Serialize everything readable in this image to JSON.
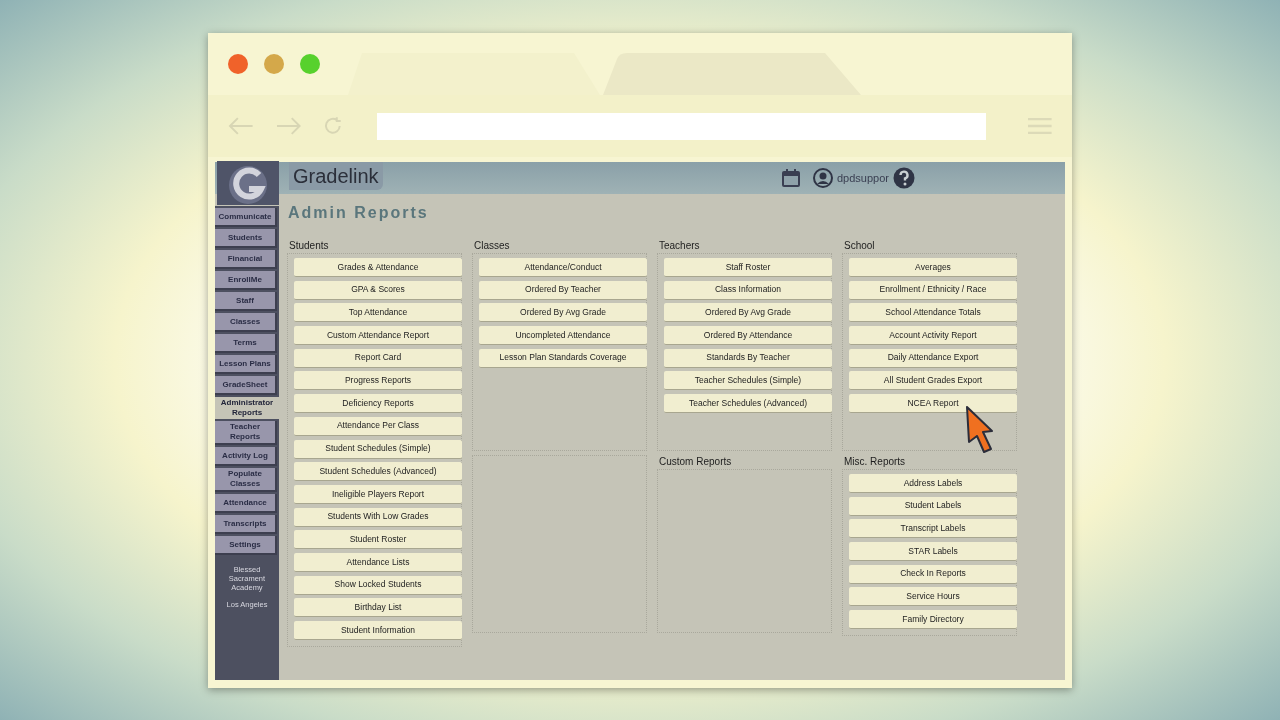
{
  "header": {
    "brand": "Gradelink",
    "user": "dpdsuppor"
  },
  "title": "Admin Reports",
  "sidebar": {
    "items": [
      {
        "label": "Communicate",
        "selected": false
      },
      {
        "label": "Students",
        "selected": false
      },
      {
        "label": "Financial",
        "selected": false
      },
      {
        "label": "EnrollMe",
        "selected": false
      },
      {
        "label": "Staff",
        "selected": false
      },
      {
        "label": "Classes",
        "selected": false
      },
      {
        "label": "Terms",
        "selected": false
      },
      {
        "label": "Lesson Plans",
        "selected": false
      },
      {
        "label": "GradeSheet",
        "selected": false
      },
      {
        "label": "Administrator Reports",
        "selected": true
      },
      {
        "label": "Teacher Reports",
        "selected": false
      },
      {
        "label": "Activity Log",
        "selected": false
      },
      {
        "label": "Populate Classes",
        "selected": false
      },
      {
        "label": "Attendance",
        "selected": false
      },
      {
        "label": "Transcripts",
        "selected": false
      },
      {
        "label": "Settings",
        "selected": false
      }
    ],
    "school": [
      "Blessed Sacrament Academy",
      "Los Angeles"
    ]
  },
  "sections": [
    {
      "title": "Students",
      "buttons": [
        "Grades & Attendance",
        "GPA & Scores",
        "Top Attendance",
        "Custom Attendance Report",
        "Report Card",
        "Progress Reports",
        "Deficiency Reports",
        "Attendance Per Class",
        "Student Schedules (Simple)",
        "Student Schedules (Advanced)",
        "Ineligible Players Report",
        "Students With Low Grades",
        "Student Roster",
        "Attendance Lists",
        "Show Locked Students",
        "Birthday List",
        "Student Information"
      ]
    },
    {
      "title": "Classes",
      "buttons": [
        "Attendance/Conduct",
        "Ordered By Teacher",
        "Ordered By Avg Grade",
        "Uncompleted Attendance",
        "Lesson Plan Standards Coverage"
      ]
    },
    {
      "title": "Teachers",
      "buttons": [
        "Staff Roster",
        "Class Information",
        "Ordered By Avg Grade",
        "Ordered By Attendance",
        "Standards By Teacher",
        "Teacher Schedules (Simple)",
        "Teacher Schedules (Advanced)"
      ]
    },
    {
      "title": "School",
      "buttons": [
        "Averages",
        "Enrollment / Ethnicity / Race",
        "School Attendance Totals",
        "Account Activity Report",
        "Daily Attendance Export",
        "All Student Grades Export",
        "NCEA Report"
      ]
    },
    {
      "title": "Custom Reports"
    },
    {
      "title": "Misc. Reports",
      "buttons": [
        "Address Labels",
        "Student Labels",
        "Transcript Labels",
        "STAR Labels",
        "Check In Reports",
        "Service Hours",
        "Family Directory"
      ]
    }
  ]
}
